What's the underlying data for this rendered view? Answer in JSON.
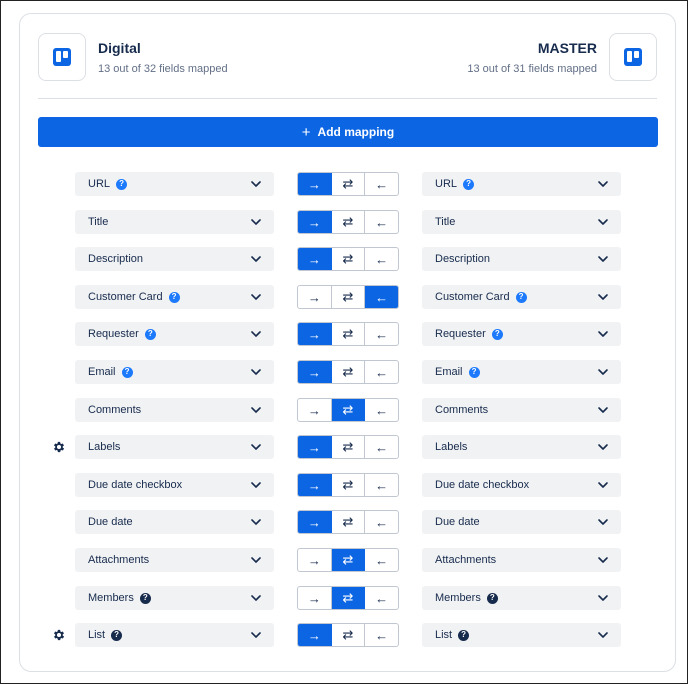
{
  "header": {
    "left": {
      "name": "Digital",
      "status": "13 out of 32 fields mapped",
      "icon": "trello-board-icon"
    },
    "right": {
      "name": "MASTER",
      "status": "13 out of 31 fields mapped",
      "icon": "trello-board-icon"
    }
  },
  "add_mapping": {
    "label": "Add mapping",
    "icon": "plus-icon"
  },
  "direction_glyphs": {
    "to_right": "→",
    "both": "⇄",
    "to_left": "←"
  },
  "colors": {
    "accent": "#0c66e4",
    "help_blue": "#1d7afc",
    "help_dark": "#172b4d",
    "field_bg": "#f1f2f4"
  },
  "mappings": [
    {
      "left": "URL",
      "right": "URL",
      "help": "blue",
      "gear": false,
      "direction": "to_right"
    },
    {
      "left": "Title",
      "right": "Title",
      "help": null,
      "gear": false,
      "direction": "to_right"
    },
    {
      "left": "Description",
      "right": "Description",
      "help": null,
      "gear": false,
      "direction": "to_right"
    },
    {
      "left": "Customer Card",
      "right": "Customer Card",
      "help": "blue",
      "gear": false,
      "direction": "to_left"
    },
    {
      "left": "Requester",
      "right": "Requester",
      "help": "blue",
      "gear": false,
      "direction": "to_right"
    },
    {
      "left": "Email",
      "right": "Email",
      "help": "blue",
      "gear": false,
      "direction": "to_right"
    },
    {
      "left": "Comments",
      "right": "Comments",
      "help": null,
      "gear": false,
      "direction": "both"
    },
    {
      "left": "Labels",
      "right": "Labels",
      "help": null,
      "gear": true,
      "direction": "to_right"
    },
    {
      "left": "Due date checkbox",
      "right": "Due date checkbox",
      "help": null,
      "gear": false,
      "direction": "to_right"
    },
    {
      "left": "Due date",
      "right": "Due date",
      "help": null,
      "gear": false,
      "direction": "to_right"
    },
    {
      "left": "Attachments",
      "right": "Attachments",
      "help": null,
      "gear": false,
      "direction": "both"
    },
    {
      "left": "Members",
      "right": "Members",
      "help": "dark",
      "gear": false,
      "direction": "both"
    },
    {
      "left": "List",
      "right": "List",
      "help": "dark",
      "gear": true,
      "direction": "to_right"
    }
  ]
}
